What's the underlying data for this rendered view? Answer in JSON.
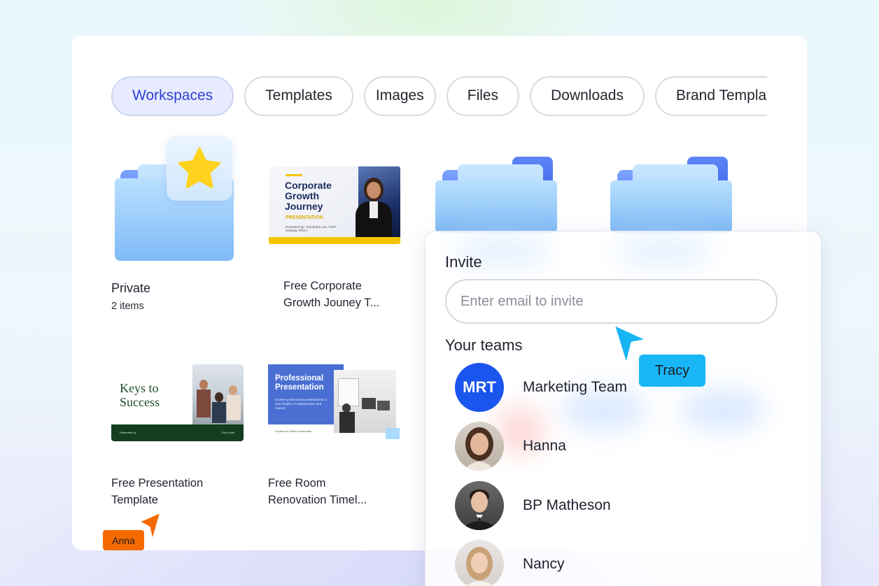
{
  "tabs": [
    {
      "label": "Workspaces",
      "active": true
    },
    {
      "label": "Templates",
      "active": false
    },
    {
      "label": "Images",
      "active": false
    },
    {
      "label": "Files",
      "active": false
    },
    {
      "label": "Downloads",
      "active": false
    },
    {
      "label": "Brand Templates",
      "active": false
    }
  ],
  "items": {
    "private": {
      "name": "Private",
      "count": "2 items"
    },
    "corporate": {
      "name_line1": "Free Corporate",
      "name_line2": "Growth Jouney T...",
      "thumb_title": "Corporate Growth Journey",
      "thumb_subtitle": "PRESENTATION",
      "thumb_presenter": "Presented By: Samantha Lee, Chief Strategy Officer"
    },
    "keys": {
      "name_line1": "Free Presentation",
      "name_line2": "Template",
      "thumb_title": "Keys to Success",
      "thumb_footer_left": "Presented by",
      "thumb_footer_right": "Roy Smith"
    },
    "room": {
      "name_line1": "Free Room",
      "name_line2": "Renovation Timel...",
      "thumb_title": "Professional Presentation",
      "thumb_text": "[Screen professional presentations to new heights of sophistication and impact]",
      "thumb_footer": "Prepared for Rafted Communities"
    }
  },
  "invite": {
    "title": "Invite",
    "placeholder": "Enter email to invite",
    "teams_title": "Your teams",
    "members": [
      {
        "name": "Marketing Team",
        "initials": "MRT"
      },
      {
        "name": "Hanna"
      },
      {
        "name": "BP Matheson"
      },
      {
        "name": "Nancy"
      }
    ]
  },
  "cursors": {
    "tracy": {
      "label": "Tracy",
      "color": "#19b6f5"
    },
    "anna": {
      "label": "Anna",
      "color": "#f56a00"
    }
  },
  "colors": {
    "accent": "#2f3fd8",
    "team_avatar": "#1a55ee"
  }
}
